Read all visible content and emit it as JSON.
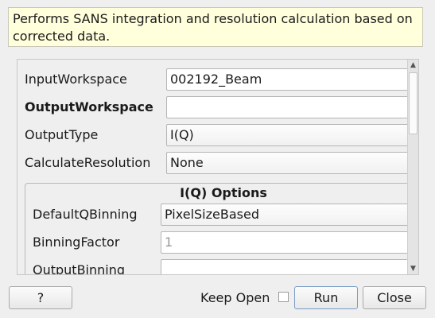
{
  "description": "Performs SANS integration and resolution calculation based on corrected data.",
  "properties": [
    {
      "label": "InputWorkspace",
      "value": "002192_Beam",
      "type": "text"
    },
    {
      "label": "OutputWorkspace",
      "value": "",
      "type": "text",
      "bold": true
    },
    {
      "label": "OutputType",
      "value": "I(Q)",
      "type": "combo"
    },
    {
      "label": "CalculateResolution",
      "value": "None",
      "type": "combo"
    }
  ],
  "group": {
    "title": "I(Q) Options",
    "properties": [
      {
        "label": "DefaultQBinning",
        "value": "PixelSizeBased",
        "type": "combo"
      },
      {
        "label": "BinningFactor",
        "placeholder": "1",
        "type": "text"
      },
      {
        "label": "OutputBinning",
        "value": "",
        "type": "text"
      }
    ]
  },
  "scroll": {
    "up_arrow": "▲",
    "down_arrow": "▼"
  },
  "footer": {
    "help_label": "?",
    "keep_open_label": "Keep Open",
    "keep_open_checked": false,
    "run_label": "Run",
    "close_label": "Close"
  }
}
